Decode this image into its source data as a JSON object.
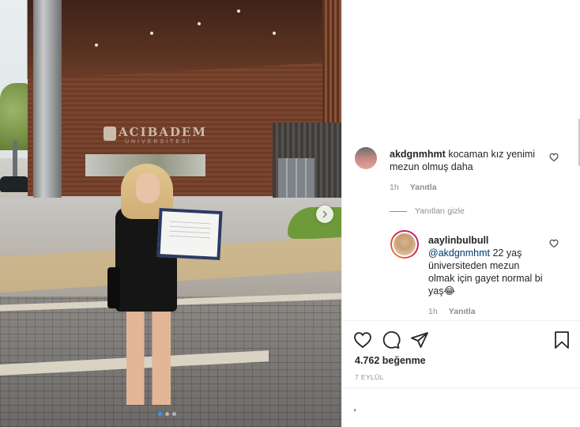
{
  "photo": {
    "sign_text": "ACIBADEM",
    "sign_sub": "ÜNİVERSİTESİ",
    "carousel": {
      "total": 3,
      "active": 1
    }
  },
  "comments": [
    {
      "username": "akdgnmhmt",
      "text": "kocaman kız yenimi mezun olmuş daha",
      "time": "1h",
      "reply_label": "Yanıtla"
    }
  ],
  "hide_replies_label": "Yanıtları gizle",
  "replies": [
    {
      "username": "aaylinbulbull",
      "mention": "@akdgnmhmt",
      "text": "22 yaş üniversiteden mezun olmak için gayet normal bi yaş😂",
      "time": "1h",
      "reply_label": "Yanıtla"
    }
  ],
  "post": {
    "likes": "4.762 beğenme",
    "date": "7 EYLÜL"
  },
  "add_comment": {
    "value": "،",
    "placeholder": "",
    "post_label": ""
  },
  "colors": {
    "link": "#00376b",
    "muted": "#8e8e8e",
    "text": "#262626",
    "accent": "#3897f0"
  }
}
